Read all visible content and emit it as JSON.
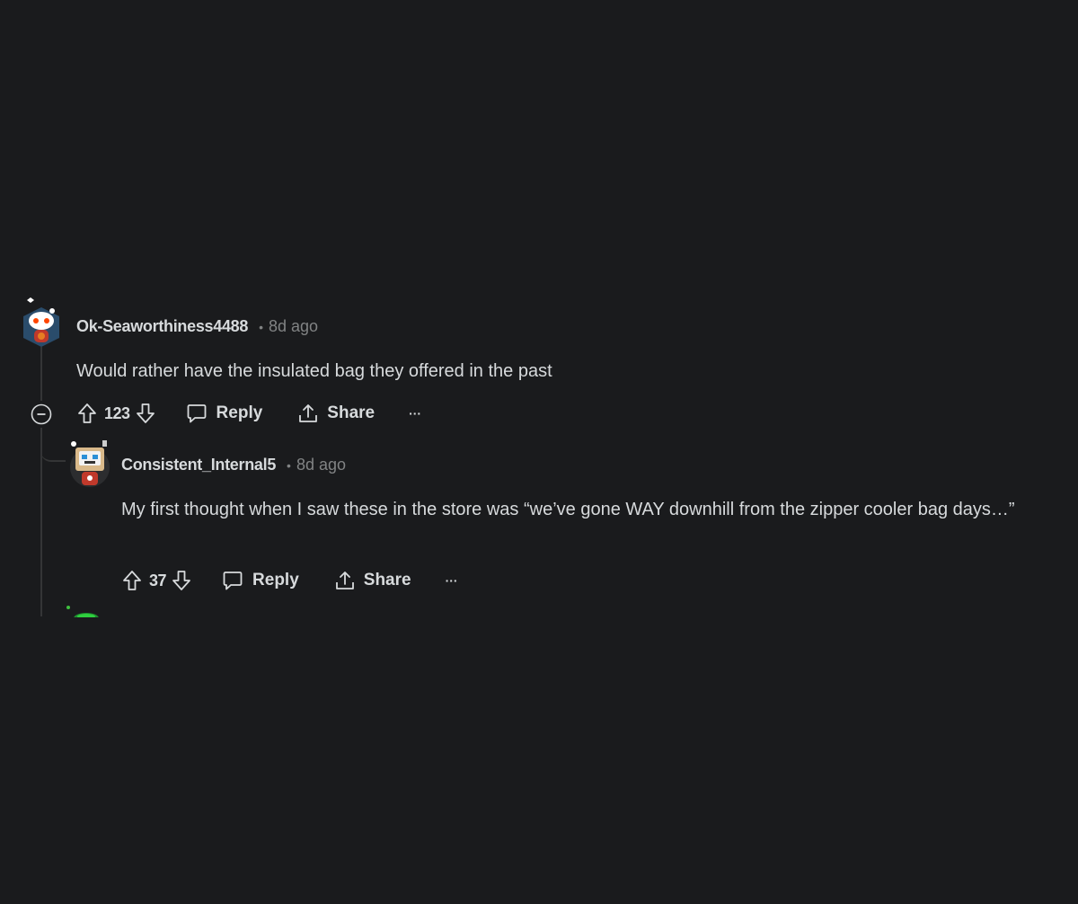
{
  "comments": [
    {
      "author": "Ok-Seaworthiness4488",
      "separator": "•",
      "time": "8d ago",
      "body": "Would rather have the insulated bag they offered in the past",
      "score": "123",
      "reply_label": "Reply",
      "share_label": "Share",
      "more_label": "···",
      "avatar_icon": "snoo-avatar-icon"
    },
    {
      "author": "Consistent_Internal5",
      "separator": "•",
      "time": "8d ago",
      "body": "My first thought when I saw these in the store was “we’ve gone WAY downhill from the zipper cooler bag days…”",
      "score": "37",
      "reply_label": "Reply",
      "share_label": "Share",
      "more_label": "···",
      "avatar_icon": "robot-avatar-icon"
    }
  ],
  "colors": {
    "background": "#1a1b1d",
    "text": "#d7dadc",
    "muted": "#818384",
    "thread_line": "#343536"
  }
}
